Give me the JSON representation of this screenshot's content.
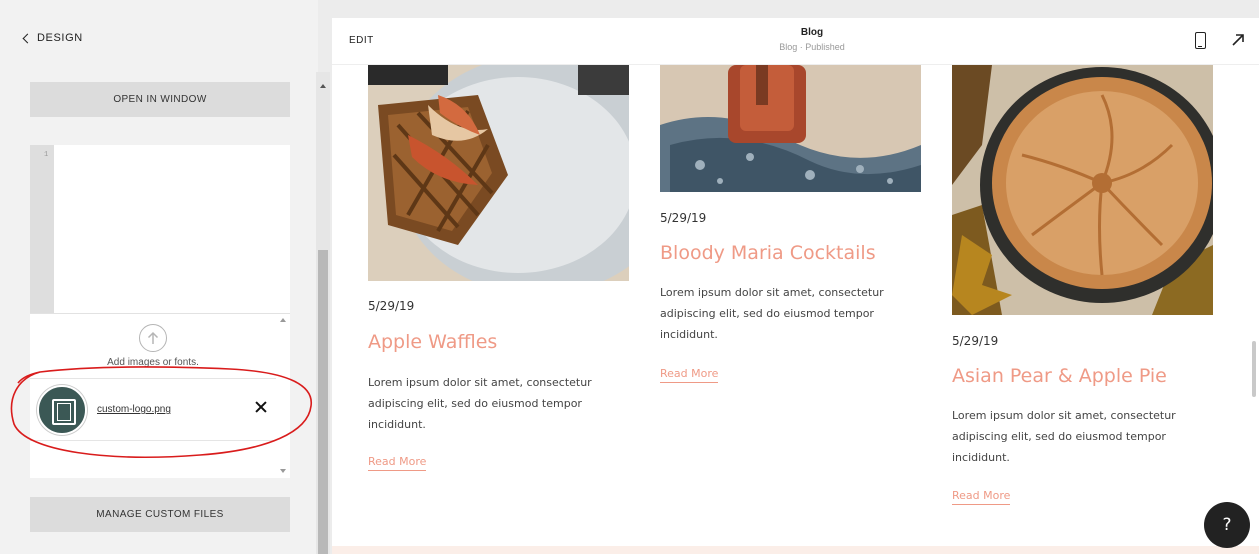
{
  "sidebar": {
    "back_label": "DESIGN",
    "open_window_label": "OPEN IN WINDOW",
    "code_line_number": "1",
    "upload_text": "Add images or fonts.",
    "file": {
      "name": "custom-logo.png"
    },
    "manage_label": "MANAGE CUSTOM FILES"
  },
  "topbar": {
    "edit_label": "EDIT",
    "title": "Blog",
    "subtitle": "Blog · Published"
  },
  "posts": [
    {
      "date": "5/29/19",
      "title": "Apple Waffles",
      "excerpt": "Lorem ipsum dolor sit amet, consectetur adipiscing elit, sed do eiusmod tempor incididunt.",
      "read_more": "Read More"
    },
    {
      "date": "5/29/19",
      "title": "Bloody Maria Cocktails",
      "excerpt": "Lorem ipsum dolor sit amet, consectetur adipiscing elit, sed do eiusmod tempor incididunt.",
      "read_more": "Read More"
    },
    {
      "date": "5/29/19",
      "title": "Asian Pear & Apple Pie",
      "excerpt": "Lorem ipsum dolor sit amet, consectetur adipiscing elit, sed do eiusmod tempor incididunt.",
      "read_more": "Read More"
    }
  ],
  "help": {
    "label": "?"
  },
  "colors": {
    "accent": "#ef9a86",
    "annotation": "#d91c1c",
    "panel_bg": "#f2f2f2"
  },
  "icons": [
    "chevron-left-icon",
    "upload-arrow-icon",
    "close-icon",
    "mobile-preview-icon",
    "expand-arrow-icon"
  ]
}
